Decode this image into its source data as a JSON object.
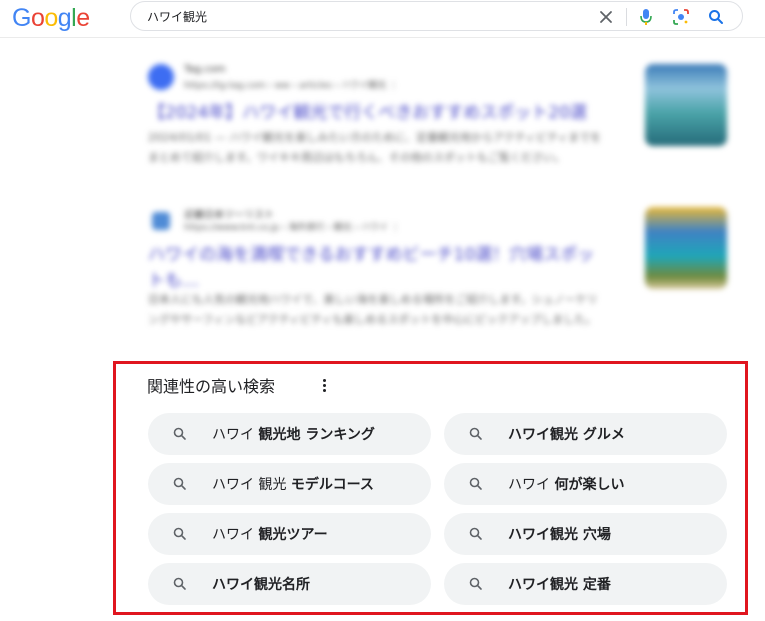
{
  "logo": [
    "G",
    "o",
    "o",
    "g",
    "l",
    "e"
  ],
  "search": {
    "query": "ハワイ観光"
  },
  "results": [
    {
      "site": "Tag.com",
      "url": "https://tg-tag.com › ww › articles › ハワイ観光 ⋮",
      "title": "【2024年】ハワイ観光で行くべきおすすめスポット20選",
      "snippet": "2024/01/01 — ハワイ観光を楽しみたい方のために、定番観光地からアクティビティまでをまとめて紹介します。ワイキキ周辺はもちろん、その他のスポットもご覧ください。"
    },
    {
      "site": "近畿日本ツーリスト",
      "url": "https://www.knt.co.jp › 海外旅行 › 観光 › ハワイ ⋮",
      "title": "ハワイの海を満喫できるおすすめビーチ10選！穴場スポットも…",
      "snippet": "日本人にも人気の観光地ハワイで、美しい海を楽しめる場所をご紹介します。シュノーケリングやサーフィンなどアクティビティも楽しめるスポットを中心にピックアップしました。"
    }
  ],
  "related": {
    "title": "関連性の高い検索",
    "items": [
      {
        "parts": [
          {
            "t": "ハワイ ",
            "b": false
          },
          {
            "t": "観光地 ランキング",
            "b": true
          }
        ]
      },
      {
        "parts": [
          {
            "t": "ハワイ観光 グルメ",
            "b": true
          }
        ]
      },
      {
        "parts": [
          {
            "t": "ハワイ 観光 ",
            "b": false
          },
          {
            "t": "モデルコース",
            "b": true
          }
        ]
      },
      {
        "parts": [
          {
            "t": "ハワイ ",
            "b": false
          },
          {
            "t": "何が楽しい",
            "b": true
          }
        ]
      },
      {
        "parts": [
          {
            "t": "ハワイ ",
            "b": false
          },
          {
            "t": "観光ツアー",
            "b": true
          }
        ]
      },
      {
        "parts": [
          {
            "t": "ハワイ観光 穴場",
            "b": true
          }
        ]
      },
      {
        "parts": [
          {
            "t": "ハワイ観光名所",
            "b": true
          }
        ]
      },
      {
        "parts": [
          {
            "t": "ハワイ観光 定番",
            "b": true
          }
        ]
      }
    ]
  },
  "icons": {
    "clear": "close-icon",
    "voice": "mic-icon",
    "lens": "lens-icon",
    "search": "search-icon",
    "chip": "search-icon",
    "menu": "more-vert-icon"
  },
  "colors": {
    "highlight_border": "#e0151f",
    "chip_bg": "#f1f3f4",
    "link": "#1a0dab"
  }
}
